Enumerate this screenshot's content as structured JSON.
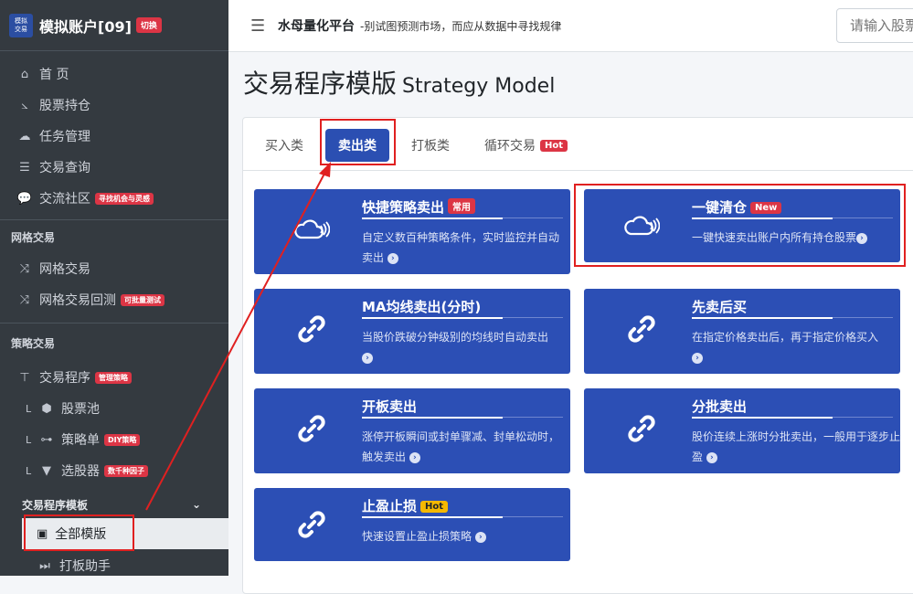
{
  "sidebar": {
    "brand_logo_line1": "模拟",
    "brand_logo_line2": "交易",
    "brand_title": "模拟账户[09]",
    "brand_switch": "切换",
    "main_items": [
      {
        "label": "首 页",
        "icon": "home-icon"
      },
      {
        "label": "股票持仓",
        "icon": "chart-line-icon"
      },
      {
        "label": "任务管理",
        "icon": "cloud-icon"
      },
      {
        "label": "交易查询",
        "icon": "list-icon"
      },
      {
        "label": "交流社区",
        "icon": "comments-icon",
        "badge": "寻找机会与灵感"
      }
    ],
    "grid_section": "网格交易",
    "grid_items": [
      {
        "label": "网格交易",
        "icon": "shuffle-icon"
      },
      {
        "label": "网格交易回测",
        "icon": "shuffle-icon",
        "badge": "可批量测试"
      }
    ],
    "strategy_section": "策略交易",
    "strategy_program": {
      "label": "交易程序",
      "badge": "管理策略"
    },
    "strategy_sub": [
      {
        "label": "股票池",
        "icon": "cube-icon"
      },
      {
        "label": "策略单",
        "icon": "flow-icon",
        "badge": "DIY策略"
      },
      {
        "label": "选股器",
        "icon": "filter-icon",
        "badge": "数千种因子"
      }
    ],
    "template_header": "交易程序模板",
    "active_item": "全部模版",
    "last_item": "打板助手"
  },
  "topbar": {
    "site_title": "水母量化平台",
    "site_slogan": "-别试图预测市场，而应从数据中寻找规律",
    "search_placeholder": "请输入股票"
  },
  "page": {
    "title": "交易程序模版",
    "title_en": "Strategy Model"
  },
  "tabs": [
    {
      "label": "买入类"
    },
    {
      "label": "卖出类"
    },
    {
      "label": "打板类"
    },
    {
      "label": "循环交易",
      "badge": "Hot"
    }
  ],
  "tiles": [
    {
      "title": "快捷策略卖出",
      "tag": "常用",
      "desc": "自定义数百种策略条件，实时监控并自动卖出"
    },
    {
      "title": "一键清仓",
      "tag": "New",
      "desc": "一键快速卖出账户内所有持仓股票"
    },
    {
      "title": "MA均线卖出(分时)",
      "desc": "当股价跌破分钟级别的均线时自动卖出"
    },
    {
      "title": "先卖后买",
      "desc": "在指定价格卖出后，再于指定价格买入"
    },
    {
      "title": "开板卖出",
      "desc": "涨停开板瞬间或封单骤减、封单松动时，触发卖出"
    },
    {
      "title": "分批卖出",
      "desc": "股价连续上涨时分批卖出，一般用于逐步止盈"
    },
    {
      "title": "止盈止损",
      "tag": "Hot",
      "desc": "快速设置止盈止损策略"
    }
  ],
  "colors": {
    "sidebar_bg": "#343a40",
    "tile_bg": "#2c4fb5",
    "active_tab": "#2b4fb2",
    "badge_red": "#dc3545",
    "badge_yellow": "#f5b800",
    "annotation_red": "#e02020"
  }
}
